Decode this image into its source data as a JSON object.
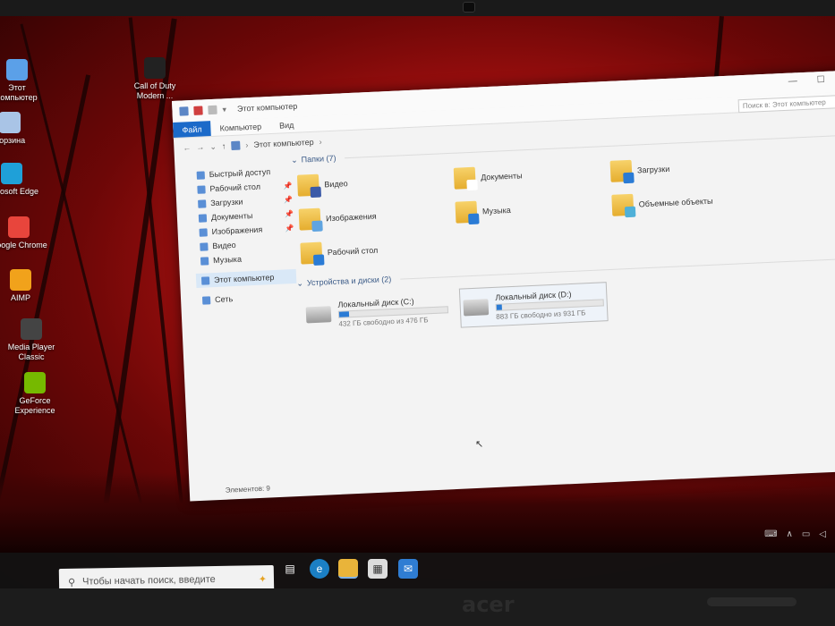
{
  "desktop": {
    "icons": [
      {
        "label": "Этот компьютер",
        "icon": "computer-icon",
        "color": "#5ba0e8"
      },
      {
        "label": "Корзина",
        "icon": "recycle-bin-icon",
        "color": "#a9c4e6"
      },
      {
        "label": "Microsoft Edge",
        "icon": "edge-icon",
        "color": "#1fa0d8"
      },
      {
        "label": "Google Chrome",
        "icon": "chrome-icon",
        "color": "#e8453c"
      },
      {
        "label": "AIMP",
        "icon": "aimp-icon",
        "color": "#f1a21b"
      },
      {
        "label": "Media Player Classic",
        "icon": "mpc-icon",
        "color": "#444444"
      },
      {
        "label": "GeForce Experience",
        "icon": "geforce-icon",
        "color": "#76b900"
      },
      {
        "label": "Call of Duty Modern ...",
        "icon": "cod-icon",
        "color": "#222222"
      }
    ]
  },
  "explorer": {
    "title": "Этот компьютер",
    "window_controls": {
      "minimize": "—",
      "maximize": "☐"
    },
    "ribbon_tabs": [
      "Файл",
      "Компьютер",
      "Вид"
    ],
    "address": "Этот компьютер",
    "search_placeholder": "Поиск в: Этот компьютер",
    "nav": [
      {
        "label": "Быстрый доступ",
        "pinned": false,
        "selected": false
      },
      {
        "label": "Рабочий стол",
        "pinned": true,
        "selected": false
      },
      {
        "label": "Загрузки",
        "pinned": true,
        "selected": false
      },
      {
        "label": "Документы",
        "pinned": true,
        "selected": false
      },
      {
        "label": "Изображения",
        "pinned": true,
        "selected": false
      },
      {
        "label": "Видео",
        "pinned": false,
        "selected": false
      },
      {
        "label": "Музыка",
        "pinned": false,
        "selected": false
      },
      {
        "label": "Этот компьютер",
        "pinned": false,
        "selected": true
      },
      {
        "label": "Сеть",
        "pinned": false,
        "selected": false
      }
    ],
    "folders_header": "Папки (7)",
    "folders": [
      {
        "label": "Видео",
        "icon": "video-folder-icon",
        "accent": "#3b5aa8"
      },
      {
        "label": "Документы",
        "icon": "documents-folder-icon",
        "accent": "#ffffff"
      },
      {
        "label": "Загрузки",
        "icon": "downloads-folder-icon",
        "accent": "#2a7bd5"
      },
      {
        "label": "Изображения",
        "icon": "pictures-folder-icon",
        "accent": "#5fa4e0"
      },
      {
        "label": "Музыка",
        "icon": "music-folder-icon",
        "accent": "#2a7bd5"
      },
      {
        "label": "Объемные объекты",
        "icon": "3d-objects-folder-icon",
        "accent": "#4fb0d8"
      },
      {
        "label": "Рабочий стол",
        "icon": "desktop-folder-icon",
        "accent": "#2a7bd5"
      }
    ],
    "drives_header": "Устройства и диски (2)",
    "drives": [
      {
        "label": "Локальный диск (C:)",
        "free": "432 ГБ свободно из 476 ГБ",
        "used_fraction": 0.09,
        "selected": false
      },
      {
        "label": "Локальный диск (D:)",
        "free": "883 ГБ свободно из 931 ГБ",
        "used_fraction": 0.05,
        "selected": true
      }
    ],
    "status": "Элементов: 9"
  },
  "taskbar": {
    "search_placeholder": "Чтобы начать поиск, введите",
    "apps": [
      "task-view-icon",
      "edge-icon",
      "file-explorer-icon",
      "store-icon",
      "mail-icon"
    ],
    "accent": "#1b6ac9"
  },
  "laptop": {
    "brand": "acer"
  }
}
